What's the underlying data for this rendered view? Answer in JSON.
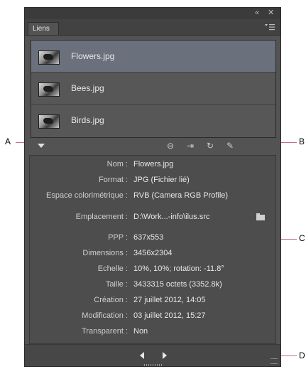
{
  "titlebar": {
    "collapse_icon": "«",
    "close_icon": "✕"
  },
  "panel": {
    "tab_label": "Liens",
    "menu_icon": "panel-menu-icon"
  },
  "links": [
    {
      "name": "Flowers.jpg",
      "selected": true
    },
    {
      "name": "Bees.jpg",
      "selected": false
    },
    {
      "name": "Birds.jpg",
      "selected": false
    }
  ],
  "toolbar": {
    "icons": [
      "show-hide-info-triangle-icon",
      "relink-chain-icon",
      "go-to-link-icon",
      "update-link-icon",
      "edit-original-pencil-icon"
    ],
    "relink_glyph": "⊖",
    "goto_glyph": "⇥",
    "update_glyph": "↻",
    "edit_glyph": "✎"
  },
  "info": [
    {
      "label": "Nom :",
      "value": "Flowers.jpg"
    },
    {
      "label": "Format :",
      "value": "JPG (Fichier lié)"
    },
    {
      "label": "Espace colorimétrique :",
      "value": "RVB (Camera RGB Profile)"
    },
    {
      "label": "Emplacement :",
      "value": "D:\\Work...-info\\ilus.src"
    },
    {
      "label": "PPP :",
      "value": "637x553"
    },
    {
      "label": "Dimensions :",
      "value": "3456x2304"
    },
    {
      "label": "Echelle :",
      "value": "10%, 10%; rotation: -11.8°"
    },
    {
      "label": "Taille :",
      "value": "3433315 octets (3352.8k)"
    },
    {
      "label": "Création :",
      "value": "27 juillet 2012, 14:05"
    },
    {
      "label": "Modification :",
      "value": "03 juillet 2012, 15:27"
    },
    {
      "label": "Transparent :",
      "value": "Non"
    }
  ],
  "callouts": {
    "a": "A",
    "b": "B",
    "c": "C",
    "d": "D"
  },
  "colors": {
    "selected_row": "#6b717c",
    "callout_line": "#c96a8f"
  }
}
